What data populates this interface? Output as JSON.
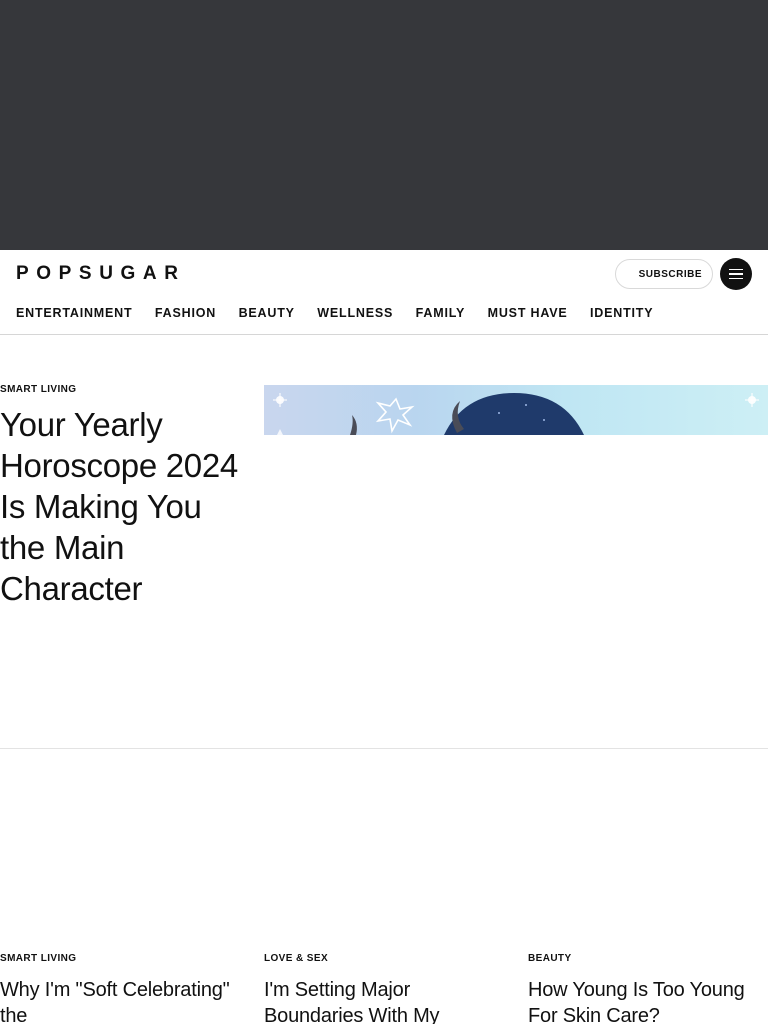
{
  "header": {
    "logo": "POPSUGAR",
    "subscribe_label": "SUBSCRIBE",
    "menu_icon": "hamburger-menu-icon"
  },
  "nav": {
    "items": [
      {
        "label": "ENTERTAINMENT"
      },
      {
        "label": "FASHION"
      },
      {
        "label": "BEAUTY"
      },
      {
        "label": "WELLNESS"
      },
      {
        "label": "FAMILY"
      },
      {
        "label": "MUST HAVE"
      },
      {
        "label": "IDENTITY"
      }
    ]
  },
  "hero": {
    "kicker": "SMART LIVING",
    "title": "Your Yearly Horoscope 2024 Is Making You the Main Character"
  },
  "cards": [
    {
      "kicker": "SMART LIVING",
      "title": "Why I'm \"Soft Celebrating\" the"
    },
    {
      "kicker": "LOVE & SEX",
      "title": "I'm Setting Major Boundaries With My"
    },
    {
      "kicker": "BEAUTY",
      "title": "How Young Is Too Young For Skin Care?"
    }
  ],
  "colors": {
    "ad_background": "#36373b",
    "text": "#111111",
    "menu_button": "#111111"
  }
}
